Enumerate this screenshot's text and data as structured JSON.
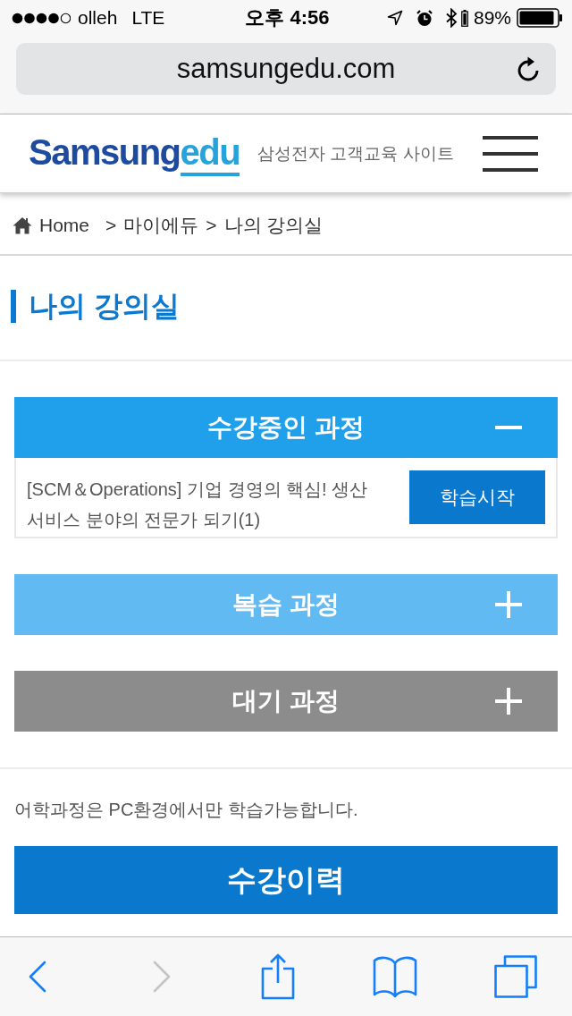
{
  "status_bar": {
    "carrier": "olleh",
    "network": "LTE",
    "time": "오후 4:56",
    "battery": "89%"
  },
  "browser": {
    "address": "samsungedu.com"
  },
  "header": {
    "logo": {
      "text": "Samsung",
      "accent": "edu"
    },
    "tagline": "삼성전자 고객교육 사이트"
  },
  "breadcrumb": [
    {
      "label": "Home"
    },
    {
      "separator": ">",
      "label": "마이에듀"
    },
    {
      "separator": ">",
      "label": "나의 강의실"
    }
  ],
  "page_title": "나의 강의실",
  "sections": [
    {
      "title": "수강중인 과정",
      "color": "#20a0ea",
      "expanded": true,
      "courses": [
        {
          "title": "[SCM＆Operations] 기업 경영의 핵심! 생산 서비스 분야의 전문가 되기(1)",
          "action": "학습시작"
        }
      ]
    },
    {
      "title": "복습 과정",
      "color": "#62baf2",
      "expanded": false
    },
    {
      "title": "대기 과정",
      "color": "#8c8c8c",
      "expanded": false
    }
  ],
  "notice": "어학과정은 PC환경에서만 학습가능합니다.",
  "history_button": "수강이력",
  "toolbar": [
    {
      "kind": "back",
      "disabled": false
    },
    {
      "kind": "forward",
      "disabled": true
    },
    {
      "kind": "share",
      "disabled": false
    },
    {
      "kind": "bookmarks",
      "disabled": false
    },
    {
      "kind": "tabs",
      "disabled": false
    }
  ]
}
